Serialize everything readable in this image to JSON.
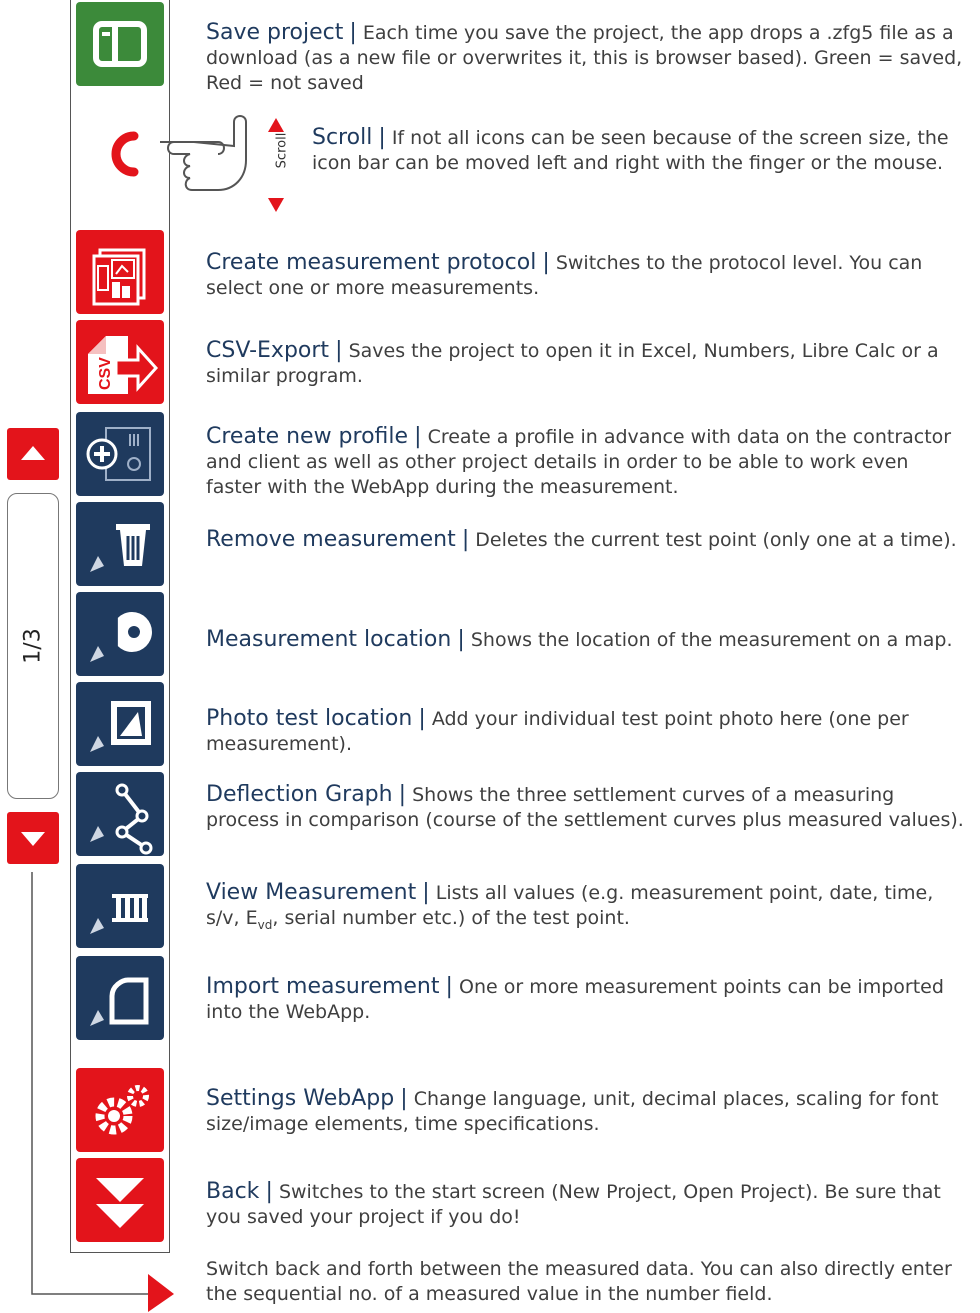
{
  "pager": {
    "label": "1/3"
  },
  "scroll_gesture": {
    "label": "Scroll"
  },
  "items": [
    {
      "title": "Save project",
      "sep": "|",
      "text": "Each time you save the project, the app drops a .zfg5 file as a download (as a new file or overwrites it, this is browser based). Green = saved, Red = not saved"
    },
    {
      "title": "Scroll",
      "sep": "|",
      "text": "If not all icons can be seen because of the screen size, the icon bar can be moved left and right with the finger or the mouse."
    },
    {
      "title": "Create measurement protocol",
      "sep": "|",
      "text": "Switches to the protocol level. You can select one or more measurements."
    },
    {
      "title": "CSV-Export",
      "sep": "|",
      "text": "Saves the project to open it in Excel, Numbers, Libre Calc or a similar program."
    },
    {
      "title": "Create new profile",
      "sep": "|",
      "text": "Create a profile in advance with data on the contractor and client as well as other project details in order to be able to work even faster with the WebApp during the measurement."
    },
    {
      "title": "Remove measurement",
      "sep": "|",
      "text": "Deletes the current test point (only one at a time)."
    },
    {
      "title": "Measurement location",
      "sep": "|",
      "text": "Shows the location of the measurement on a map."
    },
    {
      "title": "Photo test location",
      "sep": "|",
      "text": "Add your individual test point photo here (one per measurement)."
    },
    {
      "title": "Deflection Graph",
      "sep": "|",
      "text": "Shows the three settlement curves of a measuring process in comparison (course of the settlement curves plus measured values)."
    },
    {
      "title": "View Measurement",
      "sep": "|",
      "text_a": "Lists all values (e.g. measurement point, date, time, s/v, E",
      "text_sub": "vd",
      "text_b": ", serial number etc.) of the test point."
    },
    {
      "title": "Import measurement",
      "sep": "|",
      "text": "One or more measurement points can be imported into the WebApp."
    },
    {
      "title": "Settings WebApp",
      "sep": "|",
      "text": "Change language, unit, decimal places, scaling for font size/image elements, time specifications."
    },
    {
      "title": "Back",
      "sep": "|",
      "text": "Switches to the start screen (New Project, Open Project). Be sure that you saved your project if you do!"
    }
  ],
  "footer_note": "Switch back and forth between the measured data. You can also directly enter the sequential no. of a measured value in the number field.",
  "icons": [
    "save-icon",
    "scroll-hand-icon",
    "protocol-icon",
    "csv-export-icon",
    "new-profile-icon",
    "remove-measurement-icon",
    "location-icon",
    "photo-icon",
    "deflection-graph-icon",
    "view-measurement-icon",
    "import-icon",
    "settings-icon",
    "back-icon",
    "arrow-up-icon",
    "arrow-down-icon"
  ],
  "colors": {
    "green": "#3c8a3a",
    "red": "#e3141b",
    "navy": "#1f3a5e"
  }
}
